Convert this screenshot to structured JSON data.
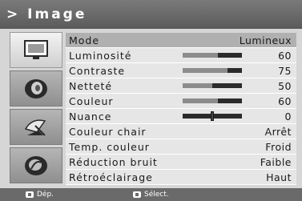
{
  "header": {
    "title": "> Image"
  },
  "sidebar": {
    "tabs": [
      {
        "icon": "picture-icon",
        "active": true
      },
      {
        "icon": "sound-icon",
        "active": false
      },
      {
        "icon": "satellite-dish-icon",
        "active": false
      },
      {
        "icon": "setup-icon",
        "active": false
      }
    ]
  },
  "menu": {
    "rows": [
      {
        "label": "Mode",
        "value": "Lumineux",
        "selected": true
      },
      {
        "label": "Luminosité",
        "value": "60",
        "level": 0.6
      },
      {
        "label": "Contraste",
        "value": "75",
        "level": 0.75
      },
      {
        "label": "Netteté",
        "value": "50",
        "level": 0.5
      },
      {
        "label": "Couleur",
        "value": "60",
        "level": 0.6
      },
      {
        "label": "Nuance",
        "value": "0",
        "balance": 0
      },
      {
        "label": "Couleur chair",
        "value": "Arrêt"
      },
      {
        "label": "Temp. couleur",
        "value": "Froid"
      },
      {
        "label": "Réduction bruit",
        "value": "Faible"
      },
      {
        "label": "Rétroéclairage",
        "value": "Haut"
      }
    ]
  },
  "footer": {
    "move_hint": "Dép.",
    "select_hint": "Sélect."
  }
}
